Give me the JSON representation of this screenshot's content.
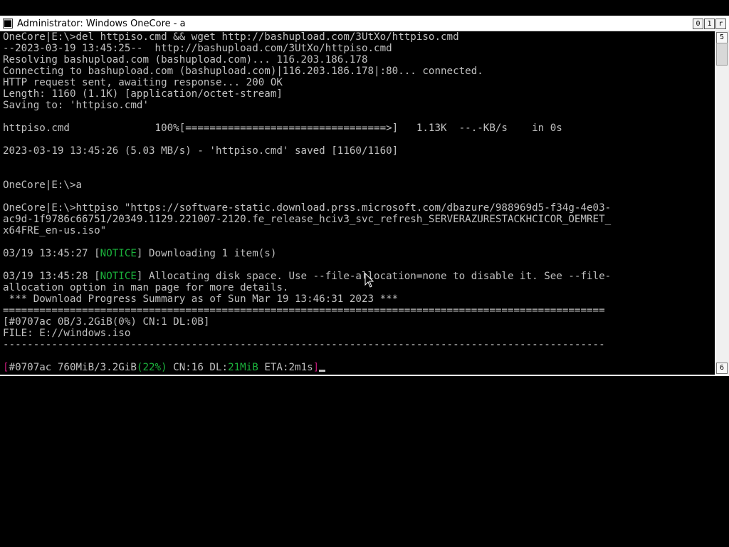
{
  "window": {
    "title": "Administrator:  Windows OneCore - a",
    "caption_buttons": [
      "0",
      "1",
      "r"
    ]
  },
  "scrollbar": {
    "up_label": "5",
    "down_label": "6"
  },
  "console": {
    "lines": [
      "OneCore|E:\\>del httpiso.cmd && wget http://bashupload.com/3UtXo/httpiso.cmd",
      "--2023-03-19 13:45:25--  http://bashupload.com/3UtXo/httpiso.cmd",
      "Resolving bashupload.com (bashupload.com)... 116.203.186.178",
      "Connecting to bashupload.com (bashupload.com)|116.203.186.178|:80... connected.",
      "HTTP request sent, awaiting response... 200 OK",
      "Length: 1160 (1.1K) [application/octet-stream]",
      "Saving to: 'httpiso.cmd'",
      "",
      "httpiso.cmd              100%[=================================>]   1.13K  --.-KB/s    in 0s",
      "",
      "2023-03-19 13:45:26 (5.03 MB/s) - 'httpiso.cmd' saved [1160/1160]",
      "",
      "",
      "OneCore|E:\\>a",
      "",
      "OneCore|E:\\>httpiso \"https://software-static.download.prss.microsoft.com/dbazure/988969d5-f34g-4e03-",
      "ac9d-1f9786c66751/20349.1129.221007-2120.fe_release_hciv3_svc_refresh_SERVERAZURESTACKHCICOR_OEMRET_",
      "x64FRE_en-us.iso\"",
      "",
      "03/19 13:45:27 [NOTICE] Downloading 1 item(s)",
      "",
      "03/19 13:45:28 [NOTICE] Allocating disk space. Use --file-allocation=none to disable it. See --file-",
      "allocation option in man page for more details.",
      " *** Download Progress Summary as of Sun Mar 19 13:46:31 2023 ***",
      "===================================================================================================",
      "[#0707ac 0B/3.2GiB(0%) CN:1 DL:0B]",
      "FILE: E://windows.iso",
      "---------------------------------------------------------------------------------------------------",
      "",
      "[#0707ac 760MiB/3.2GiB(22%) CN:16 DL:21MiB ETA:2m1s]"
    ],
    "notice_1": {
      "prefix": "03/19 13:45:27 [",
      "tag": "NOTICE",
      "suffix": "] Downloading 1 item(s)"
    },
    "notice_2": {
      "prefix": "03/19 13:45:28 [",
      "tag": "NOTICE",
      "suffix": "] Allocating disk space. Use --file-allocation=none to disable it. See --file-"
    },
    "progress_line": {
      "open": "[",
      "id_size": "#0707ac 760MiB/3.2GiB",
      "pct": "(22%)",
      "cn": " CN:16 DL:",
      "dl": "21MiB",
      "eta": " ETA:2m1s",
      "close": "]"
    }
  },
  "colors": {
    "console_bg": "#000000",
    "console_fg": "#c0c0c0",
    "notice": "#1bb33c",
    "progress_bracket": "#c21c7a"
  }
}
